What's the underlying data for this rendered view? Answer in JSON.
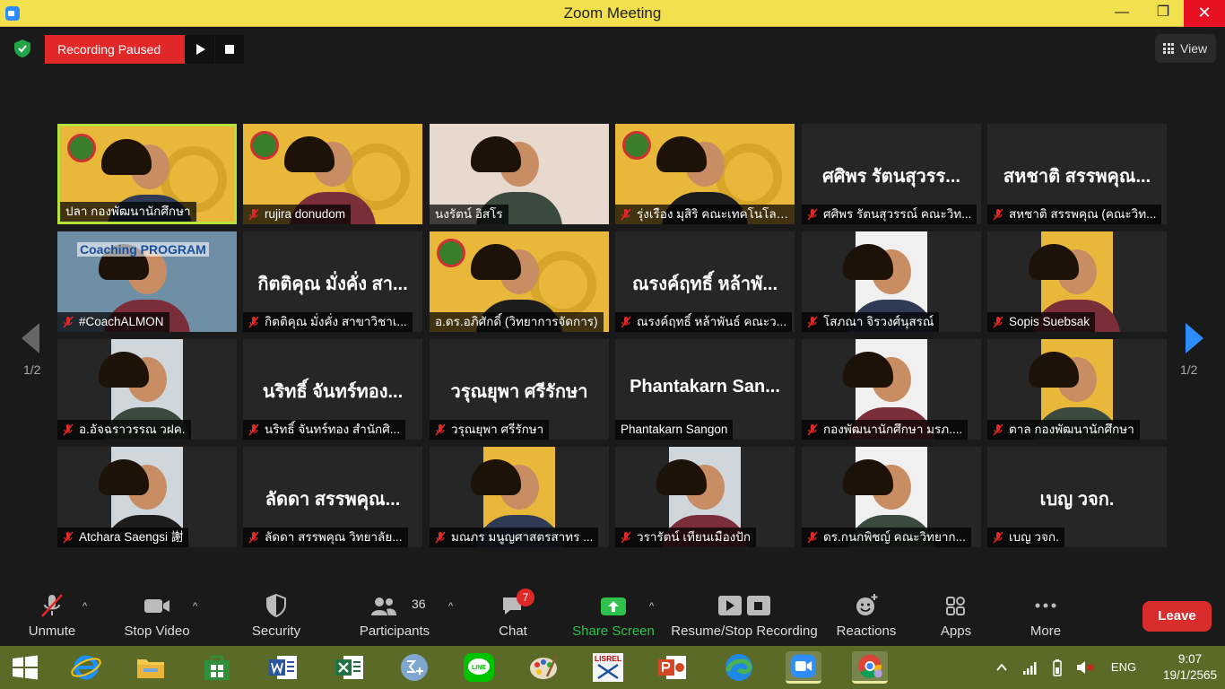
{
  "window": {
    "title": "Zoom Meeting",
    "minimize_glyph": "—",
    "maximize_glyph": "❐",
    "close_glyph": "✕"
  },
  "recording": {
    "status": "Recording Paused"
  },
  "view": {
    "label": "View"
  },
  "pagination": {
    "left": "1/2",
    "right": "1/2"
  },
  "participants": [
    {
      "name": "ปลา กองพัฒนานักศึกษา",
      "muted": false,
      "video": "poster",
      "active": true
    },
    {
      "name": "rujira donudom",
      "muted": true,
      "video": "poster"
    },
    {
      "name": "นงรัตน์ อิสโร",
      "muted": false,
      "video": "photo"
    },
    {
      "name": "รุ่งเรือง มุสิริ คณะเทคโนโลย...",
      "muted": true,
      "video": "poster"
    },
    {
      "name": "ศศิพร รัตนสุวรรณ์ คณะวิท...",
      "muted": true,
      "video": "none",
      "display_name": "ศศิพร รัตนสุวรร..."
    },
    {
      "name": "สหชาติ สรรพคุณ (คณะวิท...",
      "muted": true,
      "video": "none",
      "display_name": "สหชาติ สรรพคุณ..."
    },
    {
      "name": "#CoachALMON",
      "muted": true,
      "video": "photo",
      "overlay_text": "Coaching PROGRAM"
    },
    {
      "name": "กิตติคุณ  มั่งคั่ง สาขาวิชาเ...",
      "muted": true,
      "video": "none",
      "display_name": "กิตติคุณ  มั่งคั่ง สา..."
    },
    {
      "name": "อ.ดร.อภิศักดิ์ (วิทยาการจัดการ)",
      "muted": false,
      "video": "poster"
    },
    {
      "name": "ณรงค์ฤทธิ์ หล้าพันธ์ คณะว...",
      "muted": true,
      "video": "none",
      "display_name": "ณรงค์ฤทธิ์ หล้าพั..."
    },
    {
      "name": "โสภณา จิรวงศ์นุสรณ์",
      "muted": true,
      "video": "photo-narrow"
    },
    {
      "name": "Sopis Suebsak",
      "muted": true,
      "video": "photo-narrow"
    },
    {
      "name": "อ.อัจฉราวรรณ วฝค.",
      "muted": true,
      "video": "photo-narrow"
    },
    {
      "name": "นริทธิ์ จันทร์ทอง สำนักศิ...",
      "muted": true,
      "video": "none",
      "display_name": "นริทธิ์ จันทร์ทอง..."
    },
    {
      "name": "วรุณยุพา ศรีรักษา",
      "muted": true,
      "video": "none",
      "display_name": "วรุณยุพา ศรีรักษา"
    },
    {
      "name": "Phantakarn Sangon",
      "muted": false,
      "video": "none",
      "display_name": "Phantakarn  San..."
    },
    {
      "name": "กองพัฒนานักศึกษา มรภ....",
      "muted": true,
      "video": "photo-narrow"
    },
    {
      "name": "ตาล กองพัฒนานักศึกษา",
      "muted": true,
      "video": "photo-narrow"
    },
    {
      "name": "Atchara Saengsi 謝",
      "muted": true,
      "video": "photo-narrow"
    },
    {
      "name": "ลัดดา สรรพคุณ  วิทยาลัย...",
      "muted": true,
      "video": "none",
      "display_name": "ลัดดา สรรพคุณ..."
    },
    {
      "name": "มณภร มนูญศาสตรสาทร ...",
      "muted": true,
      "video": "photo-narrow"
    },
    {
      "name": "วรารัตน์ เทียนเมืองปัก",
      "muted": true,
      "video": "photo-narrow"
    },
    {
      "name": "ดร.กนกพิชญ์ คณะวิทยาก...",
      "muted": true,
      "video": "photo-narrow"
    },
    {
      "name": "เบญ วจก.",
      "muted": true,
      "video": "none",
      "display_name": "เบญ วจก."
    }
  ],
  "toolbar": {
    "unmute": "Unmute",
    "stop_video": "Stop Video",
    "security": "Security",
    "participants": "Participants",
    "participants_count": "36",
    "chat": "Chat",
    "chat_badge": "7",
    "share_screen": "Share Screen",
    "recording": "Resume/Stop Recording",
    "reactions": "Reactions",
    "apps": "Apps",
    "more": "More",
    "leave": "Leave",
    "caret_glyph": "^"
  },
  "taskbar": {
    "icons": [
      "windows-start-icon",
      "internet-explorer-icon",
      "file-explorer-icon",
      "store-icon",
      "word-icon",
      "excel-icon",
      "math-input-icon",
      "line-icon",
      "paint-icon",
      "lisrel-icon",
      "powerpoint-icon",
      "edge-icon",
      "zoom-icon",
      "chrome-icon"
    ],
    "lisrel_label": "LISREL",
    "language": "ENG",
    "time": "9:07",
    "date": "19/1/2565"
  },
  "colors": {
    "accent_blue": "#2d8cff",
    "record_red": "#e02828",
    "active_speaker": "#b6e33b",
    "share_green": "#2ec14b",
    "titlebar": "#f2e04f",
    "taskbar": "#5c6a27"
  }
}
